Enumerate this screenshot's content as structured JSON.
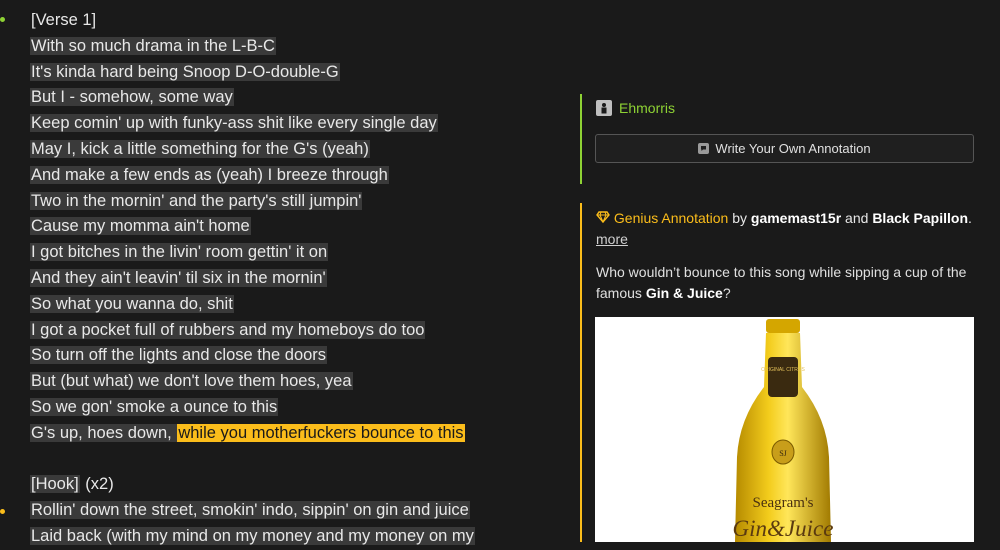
{
  "lyrics": [
    {
      "text": "[Verse 1]",
      "style": "header"
    },
    {
      "text": "With so much drama in the L-B-C",
      "style": "hl"
    },
    {
      "text": "It's kinda hard being Snoop D-O-double-G",
      "style": "hl"
    },
    {
      "text": "But I - somehow, some way",
      "style": "hl"
    },
    {
      "text": "Keep comin' up with funky-ass shit like every single day",
      "style": "hl"
    },
    {
      "text": "May I, kick a little something for the G's (yeah)",
      "style": "hl"
    },
    {
      "text": "And make a few ends as (yeah) I breeze through",
      "style": "hl"
    },
    {
      "text": "Two in the mornin' and the party's still jumpin'",
      "style": "hl"
    },
    {
      "text": "Cause my momma ain't home",
      "style": "hl"
    },
    {
      "text": "I got bitches in the livin' room gettin' it on",
      "style": "hl"
    },
    {
      "text": "And they ain't leavin' til six in the mornin'",
      "style": "hl"
    },
    {
      "text": "So what you wanna do, shit",
      "style": "hl"
    },
    {
      "text": "I got a pocket full of rubbers and my homeboys do too",
      "style": "hl"
    },
    {
      "text": "So turn off the lights and close the doors",
      "style": "hl"
    },
    {
      "text": "But (but what) we don't love them hoes, yea",
      "style": "hl"
    },
    {
      "text": "So we gon' smoke a ounce to this",
      "style": "hl"
    },
    {
      "text": "G's up, hoes down, ",
      "style": "hl",
      "highlight": "while you motherfuckers bounce to this"
    },
    {
      "text": "",
      "style": "plain"
    },
    {
      "text": "[Hook] (x2)",
      "style": "hook"
    },
    {
      "text": "Rollin' down the street, smokin' indo, sippin' on gin and juice",
      "style": "hl"
    },
    {
      "text": "Laid back (with my mind on my money and my money on my",
      "style": "hl"
    }
  ],
  "hook_header": {
    "label": "[Hook]",
    "suffix": " (x2)"
  },
  "sidebar": {
    "username": "Ehmorris",
    "write_button": "Write Your Own Annotation",
    "annotation": {
      "label": "Genius Annotation",
      "by": " by ",
      "author1": "gamemast15r",
      "and": " and ",
      "author2": "Black Papillon",
      "period": ".",
      "more": "more",
      "body_prefix": "Who wouldn’t bounce to this song while sipping a cup of the famous ",
      "body_bold": "Gin & Juice",
      "body_suffix": "?"
    },
    "image_alt": "Seagram's Gin & Juice bottle"
  },
  "bottle": {
    "brand": "Seagram's",
    "product": "Gin&Juice",
    "neck": "ORIGINAL CITRUS",
    "seal": "SJ"
  },
  "colors": {
    "accent_green": "#8ed234",
    "accent_yellow": "#fbbd1b",
    "background": "#1a1a1a"
  }
}
